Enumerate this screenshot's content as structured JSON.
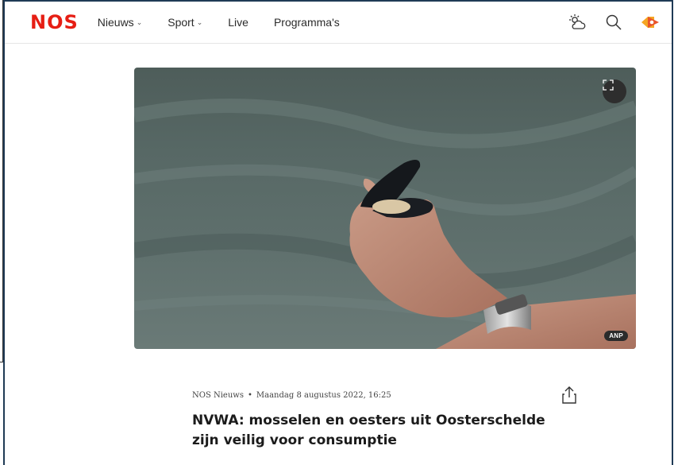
{
  "nav": {
    "logo": "NOS",
    "links": [
      {
        "label": "Nieuws",
        "has_dropdown": true
      },
      {
        "label": "Sport",
        "has_dropdown": true
      },
      {
        "label": "Live",
        "has_dropdown": false
      },
      {
        "label": "Programma's",
        "has_dropdown": false
      }
    ],
    "icons": [
      "weather-icon",
      "search-icon",
      "npo-logo-icon"
    ],
    "brand_color": "#e61e14"
  },
  "hero": {
    "credit": "ANP",
    "fullscreen_icon": "fullscreen-icon"
  },
  "article": {
    "source": "NOS Nieuws",
    "separator": "•",
    "date": "Maandag 8 augustus 2022, 16:25",
    "title": "NVWA: mosselen en oesters uit Oosterschelde zijn veilig voor consumptie",
    "share_icon": "share-icon"
  }
}
